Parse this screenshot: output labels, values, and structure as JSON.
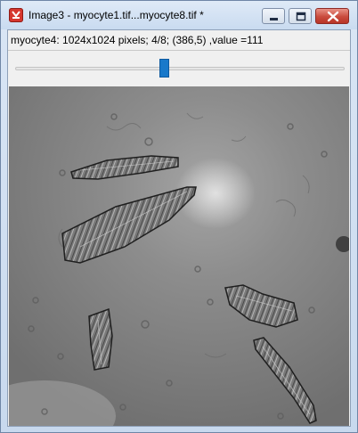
{
  "window": {
    "title": "Image3 - myocyte1.tif...myocyte8.tif *"
  },
  "info_bar": {
    "text": "myocyte4: 1024x1024 pixels; 4/8; (386,5) ,value =111"
  },
  "slice_slider": {
    "current": 4,
    "total": 8,
    "position_fraction": 0.45
  },
  "image": {
    "name": "myocyte4",
    "description_icon": "microscopy-image"
  },
  "colors": {
    "titlebar": "#c9dbf0",
    "close_button": "#c94b3e",
    "slider_thumb": "#1979ca",
    "image_background": "#7c7c7c"
  }
}
